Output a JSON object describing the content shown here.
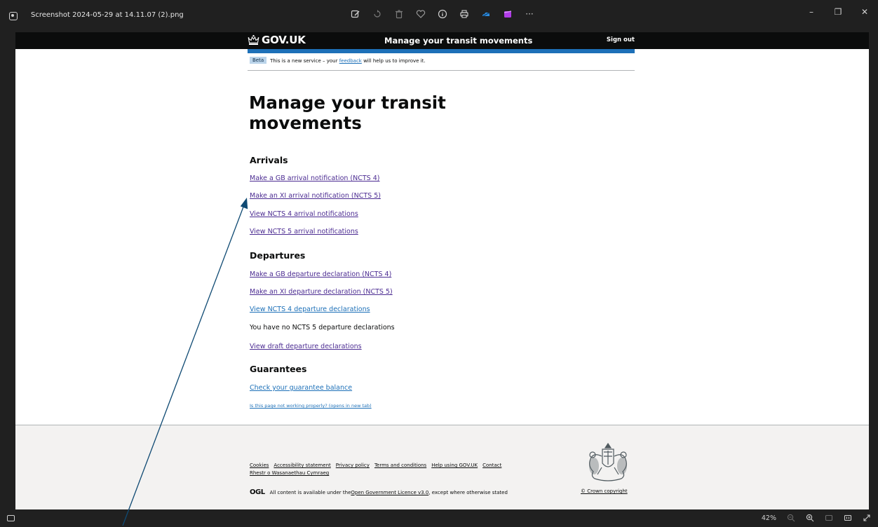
{
  "window": {
    "filename": "Screenshot 2024-05-29 at 14.11.07 (2).png",
    "toolbar_icons": [
      "edit-image-icon",
      "rotate-icon",
      "delete-icon",
      "favorite-icon",
      "info-icon",
      "print-icon",
      "onedrive-icon",
      "clipchamp-icon",
      "more-icon"
    ],
    "more_label": "···",
    "minimize_glyph": "–",
    "maximize_glyph": "❐",
    "close_glyph": "✕"
  },
  "header": {
    "logo_text": "GOV.UK",
    "service_name": "Manage your transit movements",
    "sign_out": "Sign out"
  },
  "phase_banner": {
    "tag": "Beta",
    "text_before": "This is a new service – your ",
    "link": "feedback",
    "text_after": " will help us to improve it."
  },
  "page": {
    "title": "Manage your transit movements",
    "arrivals": {
      "heading": "Arrivals",
      "links": [
        "Make a GB arrival notification (NCTS 4)",
        "Make an XI arrival notification (NCTS 5)",
        "View NCTS 4 arrival notifications",
        "View NCTS 5 arrival notifications"
      ]
    },
    "departures": {
      "heading": "Departures",
      "links": [
        "Make a GB departure declaration (NCTS 4)",
        "Make an XI departure declaration (NCTS 5)",
        "View NCTS 4 departure declarations"
      ],
      "no_ncts5": "You have no NCTS 5 departure declarations",
      "drafts_link": "View draft departure declarations"
    },
    "guarantees": {
      "heading": "Guarantees",
      "balance_link": "Check your guarantee balance"
    },
    "report_link": "Is this page not working properly? (opens in new tab)"
  },
  "footer": {
    "links": [
      "Cookies",
      "Accessibility statement",
      "Privacy policy",
      "Terms and conditions",
      "Help using GOV.UK",
      "Contact"
    ],
    "welsh_link": "Rhestr o Wasanaethau Cymraeg",
    "ogl_logo": "OGL",
    "licence_before": "All content is available under the ",
    "licence_link": "Open Government Licence v3.0",
    "licence_after": ", except where otherwise stated",
    "crown_copyright": "© Crown copyright"
  },
  "statusbar": {
    "zoom": "42%"
  },
  "colors": {
    "gov_black": "#0b0c0c",
    "gov_blue": "#1d70b8",
    "visited_link": "#4c2c92",
    "annotation_arrow": "#0f4a73"
  }
}
